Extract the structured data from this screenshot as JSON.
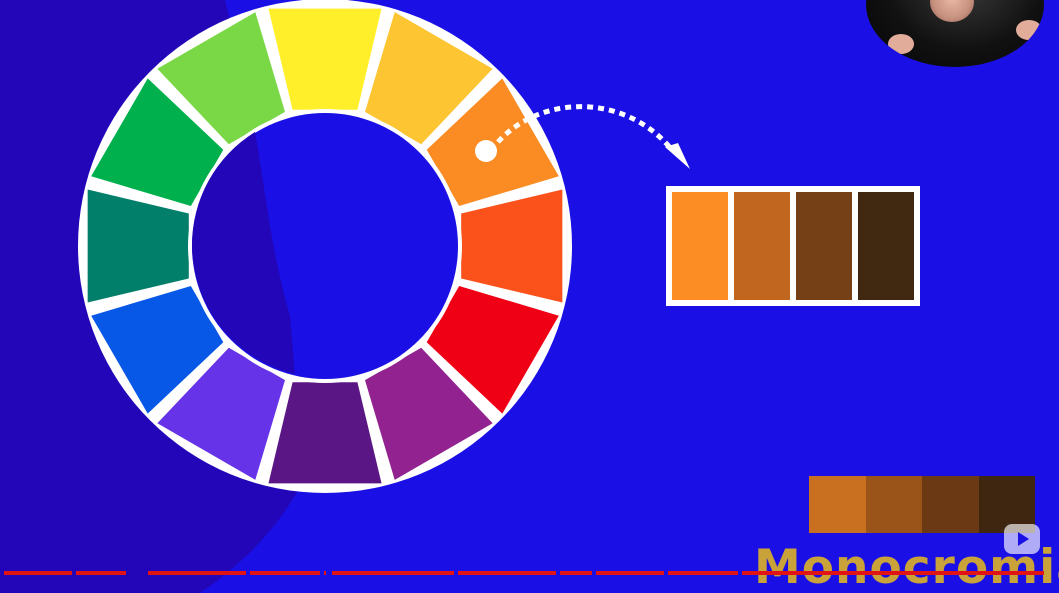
{
  "wheel": {
    "segments": [
      {
        "color": "#ffef2b"
      },
      {
        "color": "#fcc531"
      },
      {
        "color": "#fb8c24"
      },
      {
        "color": "#fb521c"
      },
      {
        "color": "#f00014"
      },
      {
        "color": "#91228f"
      },
      {
        "color": "#5a1684"
      },
      {
        "color": "#6633e8"
      },
      {
        "color": "#0858e8"
      },
      {
        "color": "#027f6b"
      },
      {
        "color": "#00b04d"
      },
      {
        "color": "#7ad847"
      }
    ],
    "highlight_segment": 2
  },
  "palette": {
    "swatches": [
      "#fb8d24",
      "#c0661e",
      "#764016",
      "#402811"
    ]
  },
  "palette_small": {
    "swatches": [
      "#c86f20",
      "#9a541a",
      "#6b3a15",
      "#3e2611"
    ]
  },
  "caption": "Monocromia",
  "colors": {
    "background": "#1a10e6",
    "shadow": "#2206b8",
    "progress": "#e01414",
    "caption": "#c9a23a",
    "ring_outline": "#ffffff"
  },
  "controls": {
    "play_icon": "play-icon"
  }
}
